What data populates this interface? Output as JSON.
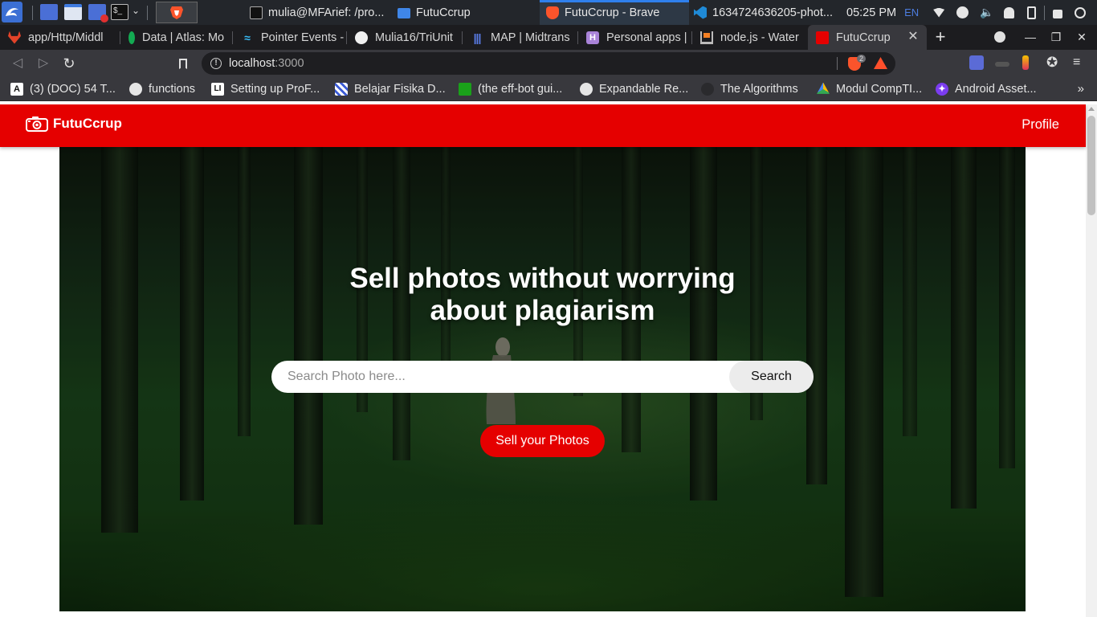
{
  "taskbar": {
    "tasks": [
      {
        "label": "mulia@MFArief: /pro...",
        "icon": "terminal-icon"
      },
      {
        "label": "FutuCcrup",
        "icon": "folder-icon"
      },
      {
        "label": "FutuCcrup - Brave",
        "icon": "brave-icon"
      },
      {
        "label": "1634724636205-phot...",
        "icon": "vscode-icon"
      }
    ],
    "clock": "05:25 PM",
    "keyboard_layout": "EN"
  },
  "browser": {
    "tabs": [
      {
        "title": "app/Http/Middl",
        "icon": "gitlab-icon"
      },
      {
        "title": "Data | Atlas: Mo",
        "icon": "mongodb-icon"
      },
      {
        "title": "Pointer Events -",
        "icon": "tailwind-icon"
      },
      {
        "title": "Mulia16/TriUnit",
        "icon": "github-icon"
      },
      {
        "title": "MAP | Midtrans",
        "icon": "midtrans-icon"
      },
      {
        "title": "Personal apps |",
        "icon": "heroku-icon"
      },
      {
        "title": "node.js - Water",
        "icon": "stackoverflow-icon"
      },
      {
        "title": "FutuCcrup",
        "icon": "futuccrup-icon",
        "active": true
      }
    ],
    "new_tab": "+",
    "url_host": "localhost",
    "url_port": ":3000",
    "shield_count": "2",
    "bookmarks": [
      {
        "label": "(3) (DOC) 54 T...",
        "icon": "academia-icon"
      },
      {
        "label": "functions",
        "icon": "globe-icon"
      },
      {
        "label": "Setting up ProF...",
        "icon": "lt-icon"
      },
      {
        "label": "Belajar Fisika D...",
        "icon": "puzzle-icon"
      },
      {
        "label": "(the eff-bot gui...",
        "icon": "green-square-icon"
      },
      {
        "label": "Expandable Re...",
        "icon": "globe-icon"
      },
      {
        "label": "The Algorithms",
        "icon": "github-icon"
      },
      {
        "label": "Modul CompTI...",
        "icon": "drive-icon"
      },
      {
        "label": "Android Asset...",
        "icon": "android-asset-icon"
      }
    ],
    "bookmarks_more": "»"
  },
  "app": {
    "brand": "FutuCcrup",
    "profile_link": "Profile",
    "hero_title_line1": "Sell photos without worrying",
    "hero_title_line2": "about plagiarism",
    "search_placeholder": "Search Photo here...",
    "search_button": "Search",
    "sell_button": "Sell your Photos",
    "colors": {
      "accent": "#e50000",
      "nav_text": "#ffffff"
    }
  }
}
